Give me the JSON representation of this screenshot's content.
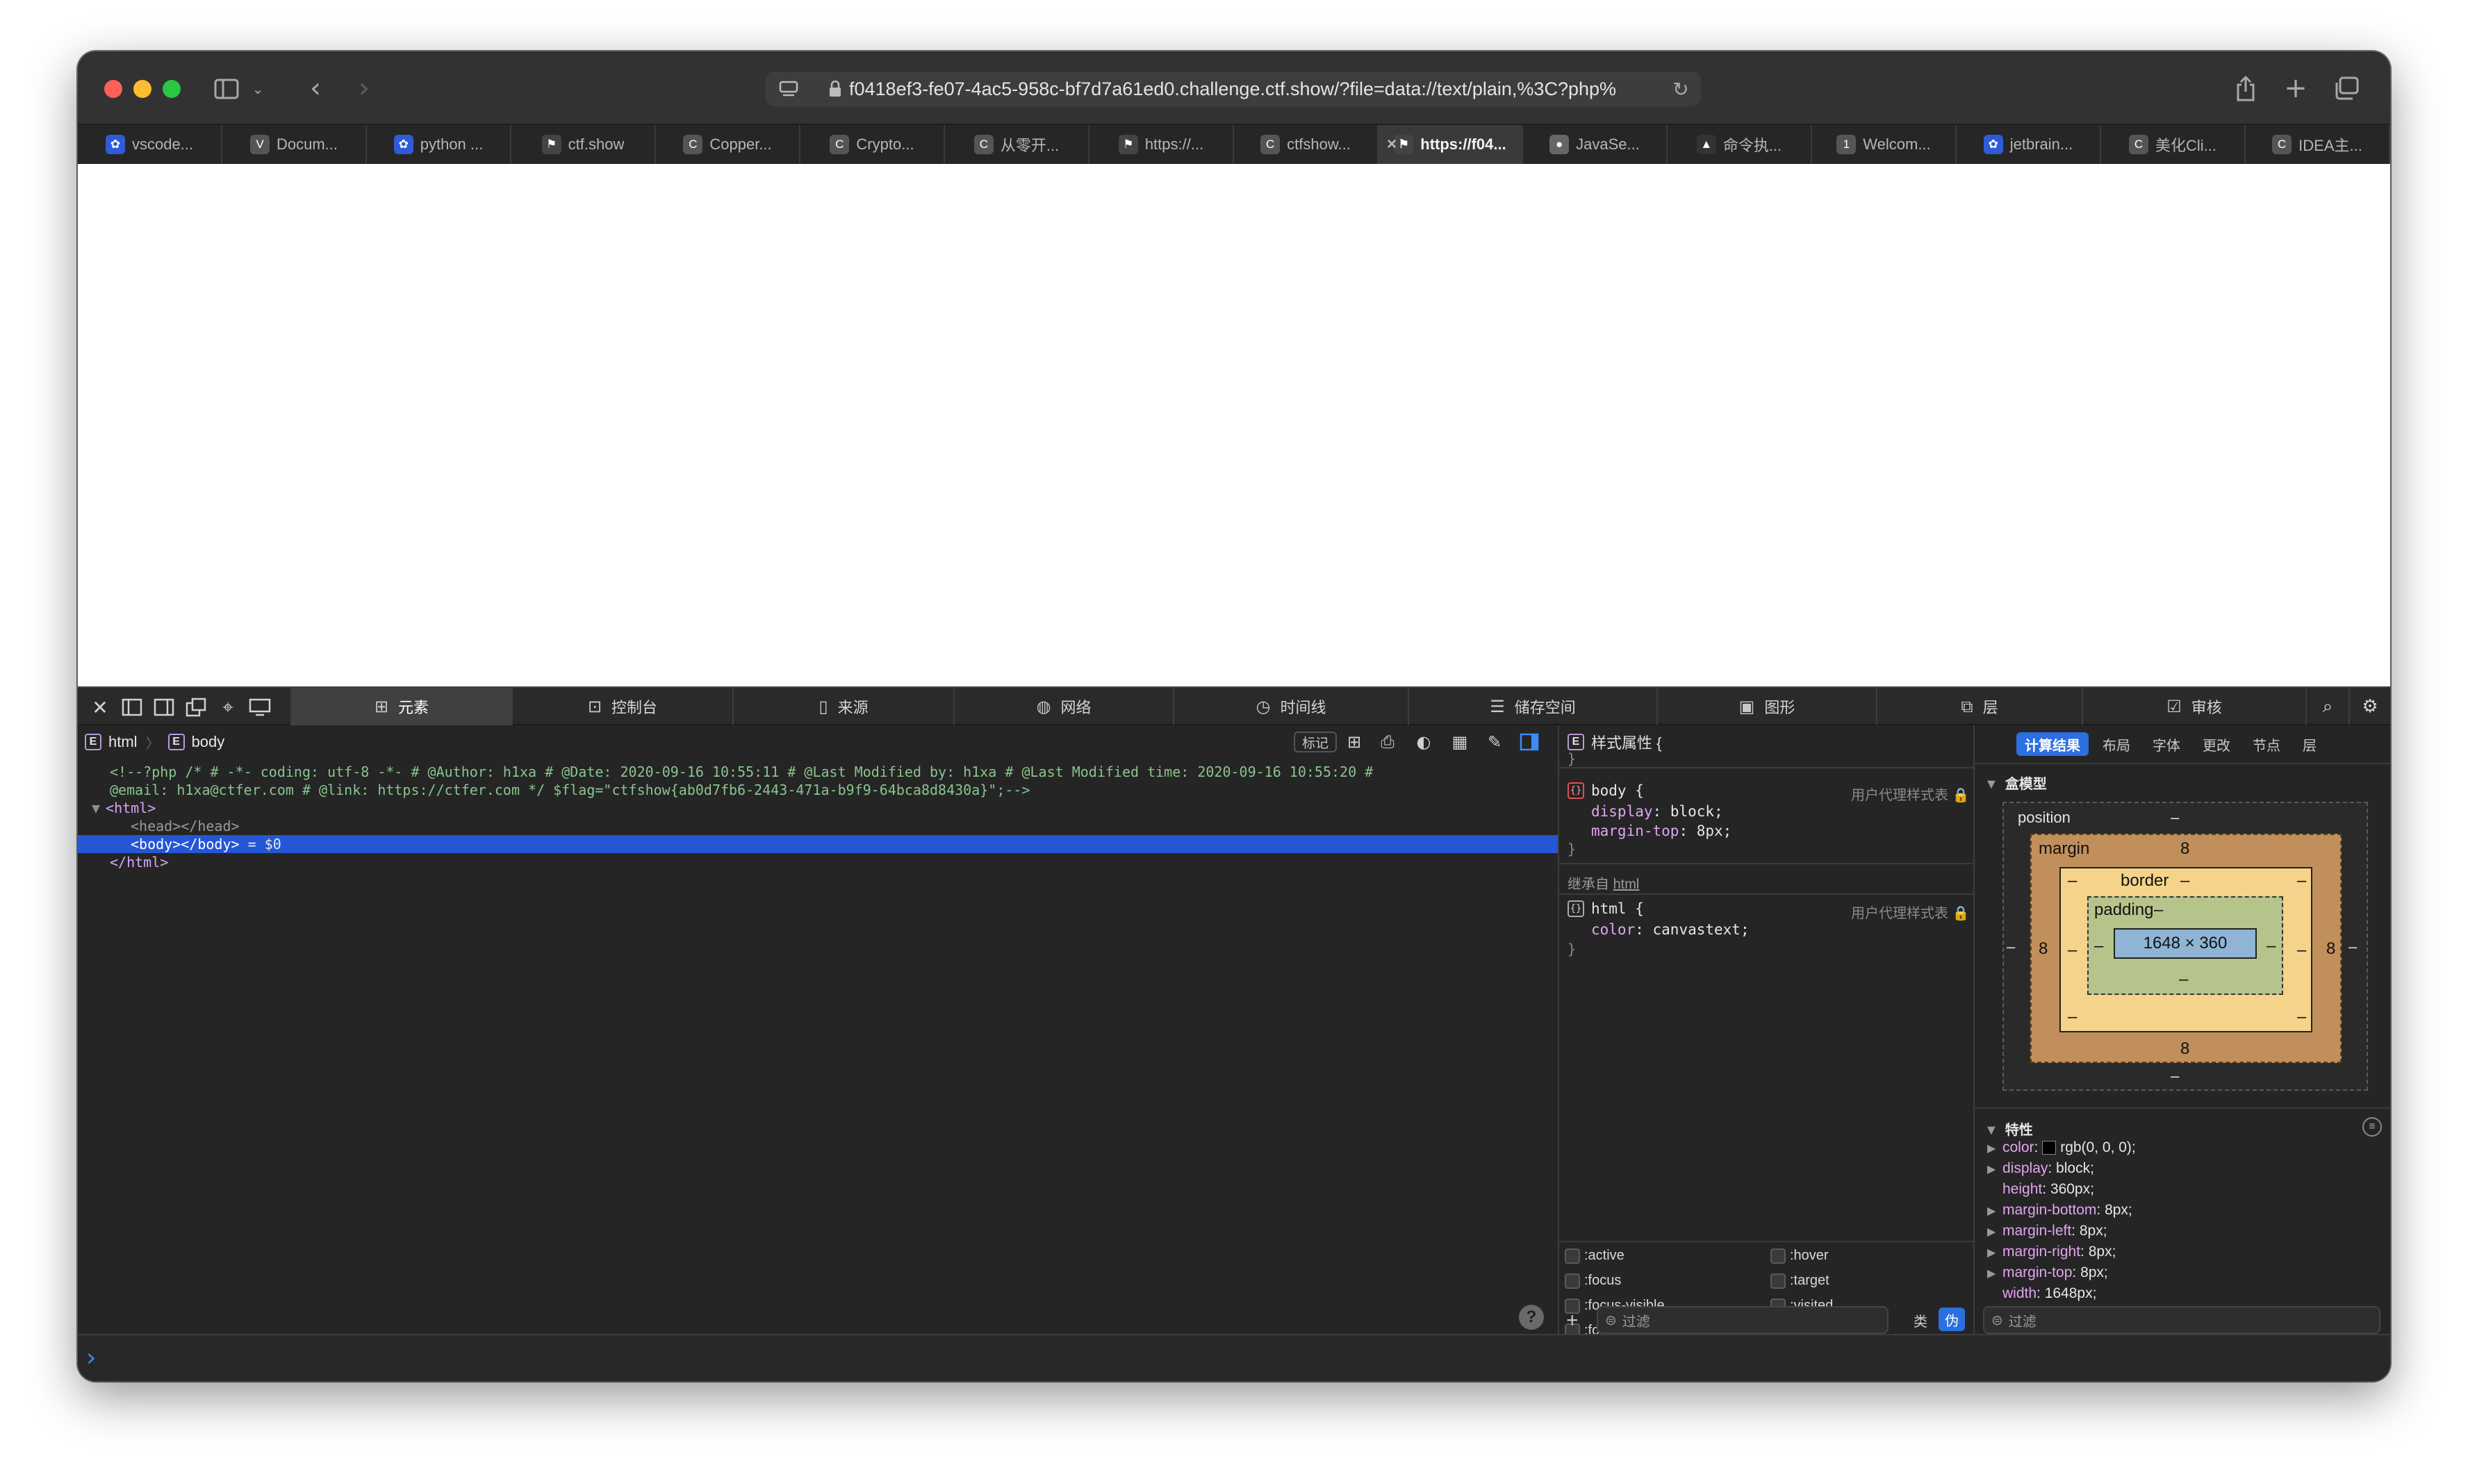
{
  "browser": {
    "url": "f0418ef3-fe07-4ac5-958c-bf7d7a61ed0.challenge.ctf.show/?file=data://text/plain,%3C?php%",
    "tabs": [
      {
        "label": "vscode...",
        "icon": "paw-icon",
        "color": "#2f5bd7",
        "glyph": "✿"
      },
      {
        "label": "Docum...",
        "icon": "v-icon",
        "color": "#555555",
        "glyph": "V"
      },
      {
        "label": "python ...",
        "icon": "paw-icon",
        "color": "#2f5bd7",
        "glyph": "✿"
      },
      {
        "label": "ctf.show",
        "icon": "figure-icon",
        "color": "#444444",
        "glyph": "⚑"
      },
      {
        "label": "Copper...",
        "icon": "c-icon",
        "color": "#555555",
        "glyph": "C"
      },
      {
        "label": "Crypto...",
        "icon": "c-icon",
        "color": "#555555",
        "glyph": "C"
      },
      {
        "label": "从零开...",
        "icon": "c-icon",
        "color": "#555555",
        "glyph": "C"
      },
      {
        "label": "https://...",
        "icon": "figure-icon",
        "color": "#444444",
        "glyph": "⚑"
      },
      {
        "label": "ctfshow...",
        "icon": "c-icon",
        "color": "#555555",
        "glyph": "C"
      },
      {
        "label": "https://f04...",
        "icon": "figure-icon",
        "color": "#444444",
        "glyph": "⚑",
        "active": true
      },
      {
        "label": "JavaSe...",
        "icon": "github-icon",
        "color": "#666666",
        "glyph": "●"
      },
      {
        "label": "命令执...",
        "icon": "rocket-icon",
        "color": "#333333",
        "glyph": "▲"
      },
      {
        "label": "Welcom...",
        "icon": "1-icon",
        "color": "#555555",
        "glyph": "1"
      },
      {
        "label": "jetbrain...",
        "icon": "paw-icon",
        "color": "#2f5bd7",
        "glyph": "✿"
      },
      {
        "label": "美化Cli...",
        "icon": "c-icon",
        "color": "#555555",
        "glyph": "C"
      },
      {
        "label": "IDEA主...",
        "icon": "c-icon",
        "color": "#555555",
        "glyph": "C"
      }
    ]
  },
  "devtools": {
    "tabs": [
      "元素",
      "控制台",
      "来源",
      "网络",
      "时间线",
      "储存空间",
      "图形",
      "层",
      "审核"
    ],
    "breadcrumb": [
      "html",
      "body"
    ],
    "mark_label": "标记",
    "source": [
      "<!--?php /* # -*- coding: utf-8 -*- # @Author: h1xa # @Date: 2020-09-16 10:55:11 # @Last Modified by: h1xa # @Last Modified time: 2020-09-16 10:55:20 #",
      "@email: h1xa@ctfer.com # @link: https://ctfer.com */ $flag=\"ctfshow{ab0d7fb6-2443-471a-b9f9-64bca8d8430a}\";-->",
      "<html>",
      "<head></head>",
      "<body></body>",
      " = $0",
      "</html>"
    ],
    "styles": {
      "title": "样式属性 {",
      "close": "}",
      "body_selector": "body {",
      "ua_label": "用户代理样式表",
      "body_props": [
        [
          "display",
          "block;"
        ],
        [
          "margin-top",
          "8px;"
        ]
      ],
      "inherit_label": "继承自",
      "inherit_link": "html",
      "html_selector": "html {",
      "html_props": [
        [
          "color",
          "canvastext;"
        ]
      ],
      "pseudo": [
        ":active",
        ":hover",
        ":focus",
        ":target",
        ":focus-visible",
        ":visited",
        ":focus-within"
      ],
      "filter": "过滤",
      "class_label": "类",
      "pseudo_label": "伪"
    },
    "computed": {
      "tabs": [
        "计算结果",
        "布局",
        "字体",
        "更改",
        "节点",
        "层"
      ],
      "box_model_label": "盒模型",
      "position_label": "position",
      "position_val": "–",
      "margin_label": "margin",
      "border_label": "border",
      "padding_label": "padding",
      "dash": "–",
      "margin_top": "8",
      "margin_bottom": "8",
      "margin_left": "8",
      "margin_right": "8",
      "content_size": "1648 × 360",
      "props_label": "特性",
      "props": [
        {
          "name": "color",
          "value": "rgb(0, 0, 0);",
          "arrow": true,
          "swatch": true
        },
        {
          "name": "display",
          "value": "block;",
          "arrow": true
        },
        {
          "name": "height",
          "value": "360px;",
          "arrow": false
        },
        {
          "name": "margin-bottom",
          "value": "8px;",
          "arrow": true
        },
        {
          "name": "margin-left",
          "value": "8px;",
          "arrow": true
        },
        {
          "name": "margin-right",
          "value": "8px;",
          "arrow": true
        },
        {
          "name": "margin-top",
          "value": "8px;",
          "arrow": true
        },
        {
          "name": "width",
          "value": "1648px;",
          "arrow": false
        }
      ],
      "filter": "过滤"
    },
    "help": "?",
    "console_prompt": "›"
  }
}
